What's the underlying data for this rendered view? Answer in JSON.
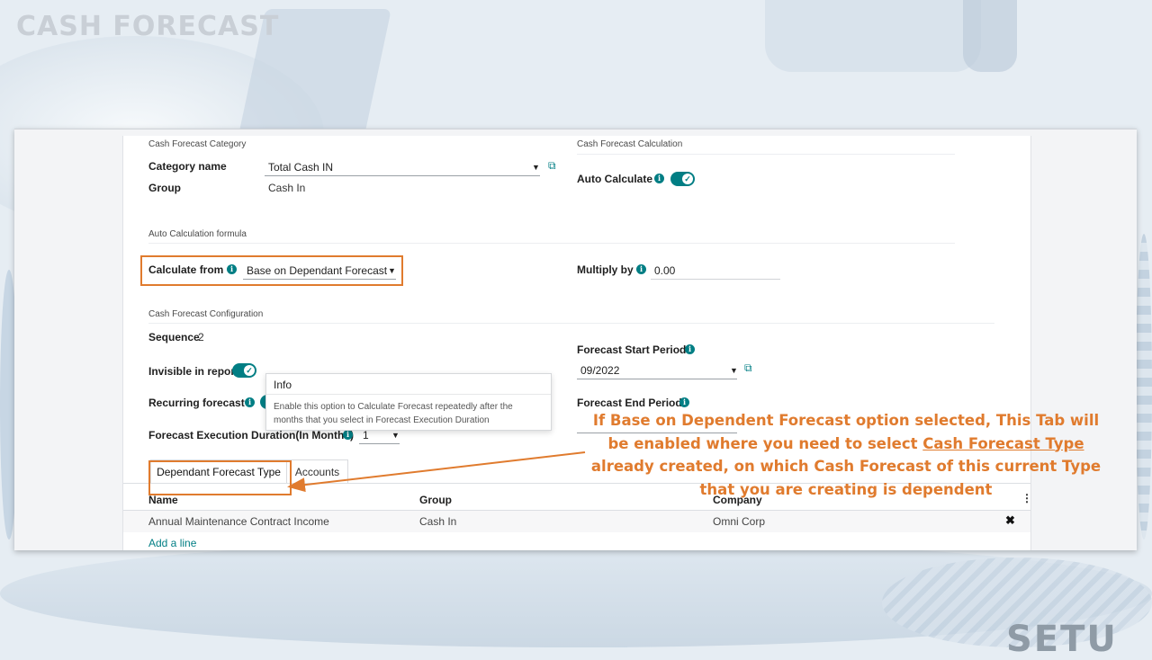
{
  "slide": {
    "title": "CASH FORECAST",
    "brand": "SETU"
  },
  "form": {
    "category_section": "Cash Forecast Category",
    "category_name_label": "Category name",
    "category_name_value": "Total Cash IN",
    "group_label": "Group",
    "group_value": "Cash In",
    "calculation_section": "Cash Forecast Calculation",
    "auto_calculate_label": "Auto Calculate",
    "auto_calculate_on": true,
    "formula_section": "Auto Calculation formula",
    "calculate_from_label": "Calculate from",
    "calculate_from_value": "Base on Dependant Forecast",
    "multiply_by_label": "Multiply by",
    "multiply_by_value": "0.00",
    "configuration_section": "Cash Forecast Configuration",
    "sequence_label": "Sequence",
    "sequence_value": "2",
    "invisible_label": "Invisible in report",
    "recurring_label": "Recurring forecast",
    "execution_label": "Forecast Execution Duration(In Months)",
    "execution_value": "1",
    "start_period_label": "Forecast Start Period",
    "start_period_value": "09/2022",
    "end_period_label": "Forecast End Period"
  },
  "tooltip": {
    "title": "Info",
    "text": "Enable this option to Calculate Forecast repeatedly after the months that you select in Forecast Execution Duration"
  },
  "tabs": [
    {
      "label": "Dependant Forecast Type",
      "active": true
    },
    {
      "label": "Accounts",
      "active": false
    }
  ],
  "table": {
    "columns": [
      "Name",
      "Group",
      "Company"
    ],
    "rows": [
      {
        "name": "Annual Maintenance Contract Income",
        "group": "Cash In",
        "company": "Omni Corp"
      }
    ],
    "add_line": "Add a line"
  },
  "callout": {
    "part1": "If Base on Dependent Forecast option selected, This Tab will be enabled where you need to select ",
    "underlined": "Cash Forecast Type ",
    "part2": "already created, on which  Cash Forecast of this current Type that you are creating  is dependent"
  },
  "colors": {
    "accent": "#017e84",
    "highlight": "#e07b2e"
  }
}
